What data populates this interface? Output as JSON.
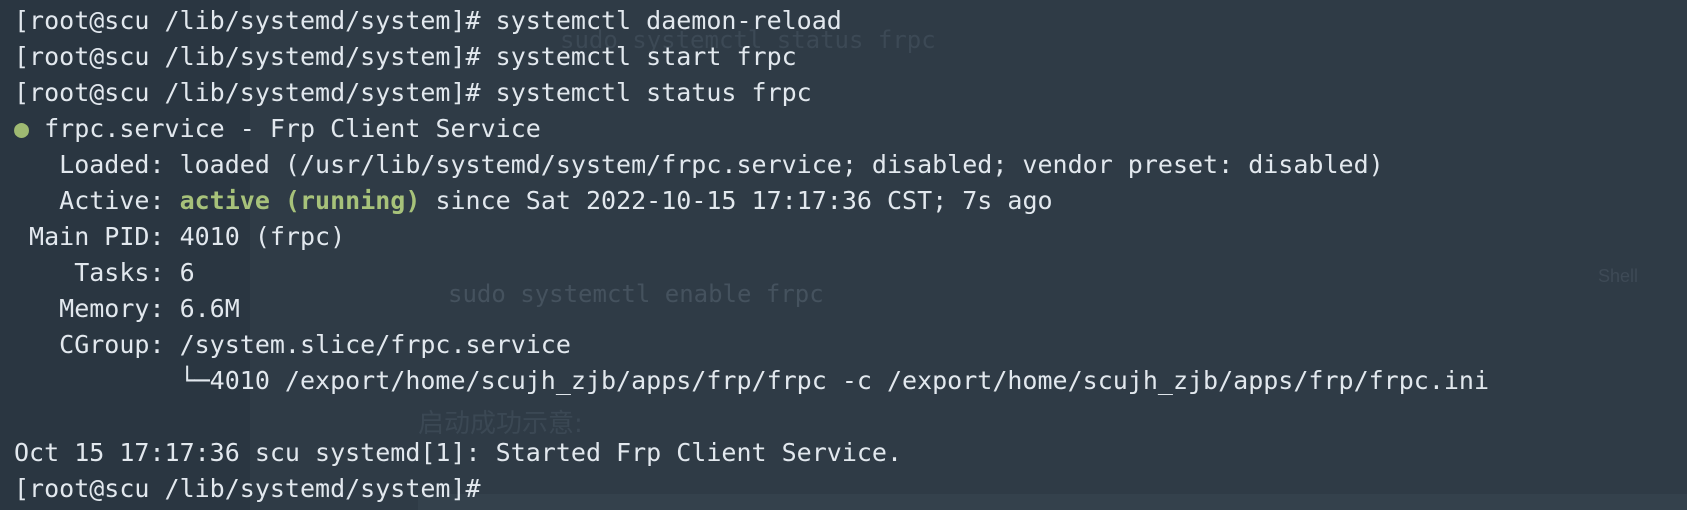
{
  "terminal": {
    "lines": [
      "[root@scu /lib/systemd/system]# systemctl daemon-reload",
      "[root@scu /lib/systemd/system]# systemctl start frpc",
      "[root@scu /lib/systemd/system]# systemctl status frpc"
    ],
    "status": {
      "bullet": "●",
      "unit_line": " frpc.service - Frp Client Service",
      "loaded": "   Loaded: loaded (/usr/lib/systemd/system/frpc.service; disabled; vendor preset: disabled)",
      "active_label": "   Active: ",
      "active_state": "active (running)",
      "active_since": " since Sat 2022-10-15 17:17:36 CST; 7s ago",
      "main_pid": " Main PID: 4010 (frpc)",
      "tasks": "    Tasks: 6",
      "memory": "   Memory: 6.6M",
      "cgroup": "   CGroup: /system.slice/frpc.service",
      "cgroup_child": "           └─4010 /export/home/scujh_zjb/apps/frp/frpc -c /export/home/scujh_zjb/apps/frp/frpc.ini"
    },
    "log_line": "Oct 15 17:17:36 scu systemd[1]: Started Frp Client Service.",
    "prompt": "[root@scu /lib/systemd/system]#"
  },
  "background_doc": {
    "code_top": "sudo systemctl status frpc",
    "code": "sudo systemctl enable frpc",
    "code_lang": "Shell",
    "heading": "启动成功示意:"
  },
  "colors": {
    "background": "#2a3641",
    "text": "#e2e8ee",
    "active_green": "#a7c27a"
  }
}
